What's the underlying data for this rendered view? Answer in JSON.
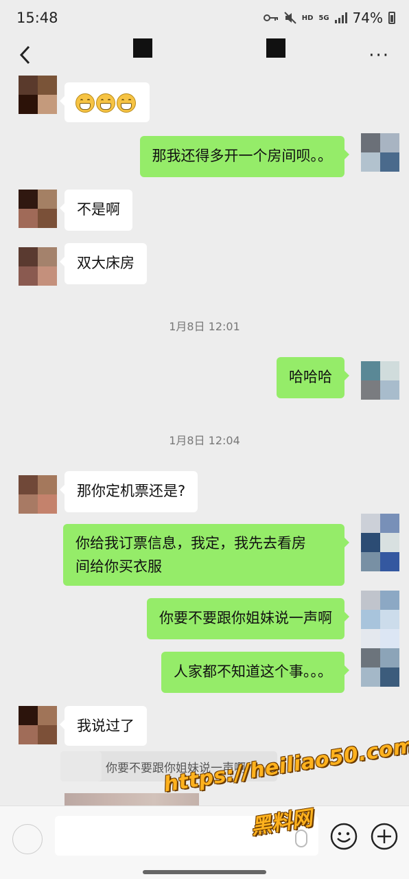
{
  "status_bar": {
    "time": "15:48",
    "network_hd": "HD",
    "network_5g": "5G",
    "battery": "74%"
  },
  "header": {
    "back_icon": "chevron-left-icon",
    "more_icon": "more-dots-icon",
    "more_label": "···"
  },
  "messages": [
    {
      "type": "in",
      "emoji": [
        "grin-emoji",
        "grin-emoji",
        "grin-emoji"
      ]
    },
    {
      "type": "out",
      "text": "那我还得多开一个房间呗。。"
    },
    {
      "type": "in",
      "text": "不是啊"
    },
    {
      "type": "in",
      "text": "双大床房"
    },
    {
      "type": "time",
      "text": "1月8日 12:01"
    },
    {
      "type": "out",
      "text": "哈哈哈"
    },
    {
      "type": "time",
      "text": "1月8日 12:04"
    },
    {
      "type": "in",
      "text": "那你定机票还是?"
    },
    {
      "type": "out",
      "lines": [
        "你给我订票信息，我定，我先去看房",
        "间给你买衣服"
      ]
    },
    {
      "type": "out",
      "text": "你要不要跟你姐妹说一声啊"
    },
    {
      "type": "out",
      "text": "人家都不知道这个事。。。"
    },
    {
      "type": "in",
      "text": "我说过了"
    },
    {
      "type": "quote",
      "text": "你要不要跟你姐妹说一声啊"
    }
  ],
  "input_bar": {
    "placeholder": "",
    "voice_icon": "voice-icon",
    "emoji_icon": "smiley-icon",
    "plus_icon": "plus-circle-icon"
  },
  "watermark": {
    "url": "https://heiliao50.com",
    "brand": "黑料网"
  },
  "colors": {
    "background": "#ededed",
    "outgoing_bubble": "#95ec69",
    "incoming_bubble": "#ffffff",
    "watermark": "#ffb21e"
  }
}
